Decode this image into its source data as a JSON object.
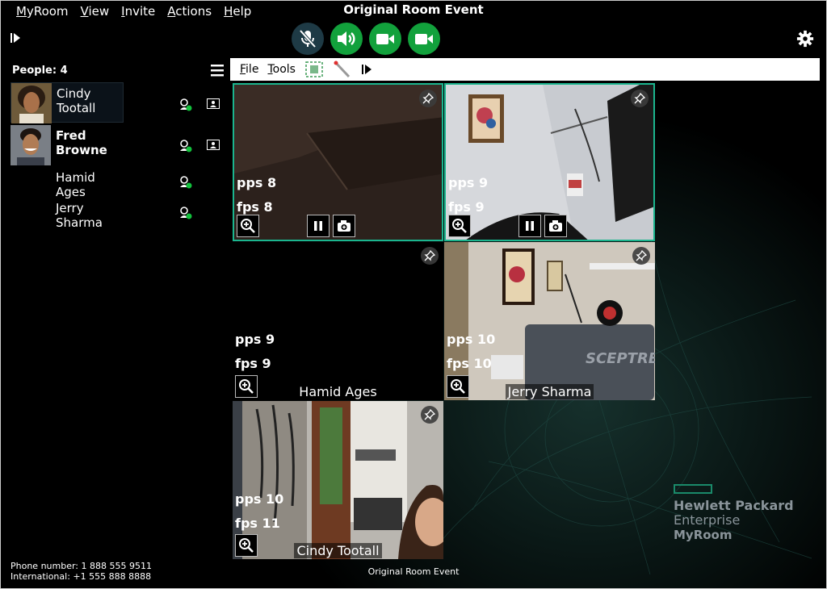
{
  "window": {
    "title": "Original Room Event"
  },
  "menu": [
    {
      "key": "M",
      "rest": "yRoom"
    },
    {
      "key": "V",
      "rest": "iew"
    },
    {
      "key": "I",
      "rest": "nvite"
    },
    {
      "key": "A",
      "rest": "ctions"
    },
    {
      "key": "H",
      "rest": "elp"
    }
  ],
  "controls": {
    "mic": "mic-muted-icon",
    "speaker": "speaker-icon",
    "camera1": "video-camera-icon",
    "camera2": "video-camera-icon",
    "accent_on": "#12a13c",
    "accent_muted": "#1e3a45"
  },
  "people": {
    "header": "People: 4",
    "list": [
      {
        "first": "Cindy",
        "last": "Tootall",
        "bold": false
      },
      {
        "first": "Fred",
        "last": "Browne",
        "bold": true
      },
      {
        "first": "Hamid",
        "last": "Ages",
        "bold": false
      },
      {
        "first": "Jerry",
        "last": "Sharma",
        "bold": false
      }
    ]
  },
  "toolbar": {
    "file_key": "F",
    "file_rest": "ile",
    "tools_key": "T",
    "tools_rest": "ools"
  },
  "tiles": [
    {
      "pps": "pps 8",
      "fps": "fps 8",
      "name": ""
    },
    {
      "pps": "pps 9",
      "fps": "fps 9",
      "name": ""
    },
    {
      "pps": "pps 9",
      "fps": "fps 9",
      "name": "Hamid Ages"
    },
    {
      "pps": "pps 10",
      "fps": "fps 10",
      "name": "Jerry Sharma"
    },
    {
      "pps": "pps 10",
      "fps": "fps 11",
      "name": "Cindy Tootall"
    }
  ],
  "phone": {
    "line1": "Phone number: 1 888 555 9511",
    "line2": "International:  +1 555 888 8888"
  },
  "status": "Original Room Event",
  "brand": {
    "line1": "Hewlett Packard",
    "line2": "Enterprise",
    "line3": "MyRoom"
  }
}
